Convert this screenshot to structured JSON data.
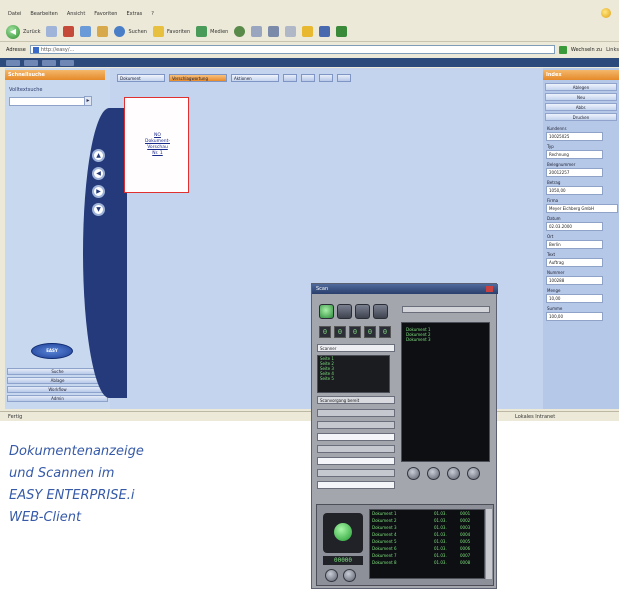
{
  "menubar": {
    "items": [
      "Datei",
      "Bearbeiten",
      "Ansicht",
      "Favoriten",
      "Extras",
      "?"
    ]
  },
  "toolbar": {
    "back": "Zurück",
    "search": "Suchen",
    "favorites": "Favoriten",
    "media": "Medien"
  },
  "address": {
    "label": "Adresse",
    "value": "http://easy/...",
    "go": "Wechseln zu",
    "links": "Links"
  },
  "app": {
    "left_header": "Schnellsuche",
    "search_label": "Volltextsuche",
    "logo_text": "EASY",
    "nav_buttons": [
      "Suche",
      "Ablage",
      "Workflow",
      "Admin"
    ],
    "toolbar_buttons": [
      "Dokument",
      "Verschlagwortung",
      "Aktionen"
    ],
    "doc_thumb_lines": [
      "NO",
      "Dokument-",
      "Vorschau",
      "Nr. 1"
    ],
    "right_header": "Index",
    "right_buttons": [
      "Ablegen",
      "Neu",
      "Abbr.",
      "Drucken"
    ],
    "right_fields": [
      {
        "label": "Kundennr.",
        "value": "10025025"
      },
      {
        "label": "Typ",
        "value": "Rechnung"
      },
      {
        "label": "Belegnummer",
        "value": "20012257"
      },
      {
        "label": "Betrag",
        "value": "1050,00"
      },
      {
        "label": "Firma",
        "value": "Meyer Eichberg GmbH"
      },
      {
        "label": "Datum",
        "value": "02.03.2000"
      },
      {
        "label": "Ort",
        "value": "Berlin"
      },
      {
        "label": "Text",
        "value": "Auftrag"
      },
      {
        "label": "Nummer",
        "value": "100288"
      },
      {
        "label": "Menge",
        "value": "10,00"
      },
      {
        "label": "Summe",
        "value": "100,00"
      }
    ]
  },
  "status": {
    "left": "Fertig",
    "right": "Lokales Intranet"
  },
  "scanner": {
    "title": "Scan",
    "digits": [
      "0",
      "0",
      "0",
      "0",
      "0"
    ],
    "dropdown": "Scanner",
    "list": [
      "Seite 1",
      "Seite 2",
      "Seite 3",
      "Seite 4",
      "Seite 5"
    ],
    "statusline": "Scanvorgang bereit",
    "preview_lines": [
      "Dokument 1",
      "Dokument 2",
      "Dokument 3"
    ],
    "counter": "00000",
    "table": [
      [
        "Dokument 1",
        "01.03.",
        "0001"
      ],
      [
        "Dokument 2",
        "01.03.",
        "0002"
      ],
      [
        "Dokument 3",
        "01.03.",
        "0003"
      ],
      [
        "Dokument 4",
        "01.03.",
        "0004"
      ],
      [
        "Dokument 5",
        "01.03.",
        "0005"
      ],
      [
        "Dokument 6",
        "01.03.",
        "0006"
      ],
      [
        "Dokument 7",
        "01.03.",
        "0007"
      ],
      [
        "Dokument 8",
        "01.03.",
        "0008"
      ]
    ]
  },
  "caption": {
    "line1": "Dokumentenanzeige",
    "line2": "und Scannen im",
    "line3": "EASY ENTERPRISE.i",
    "line4": "WEB-Client"
  }
}
